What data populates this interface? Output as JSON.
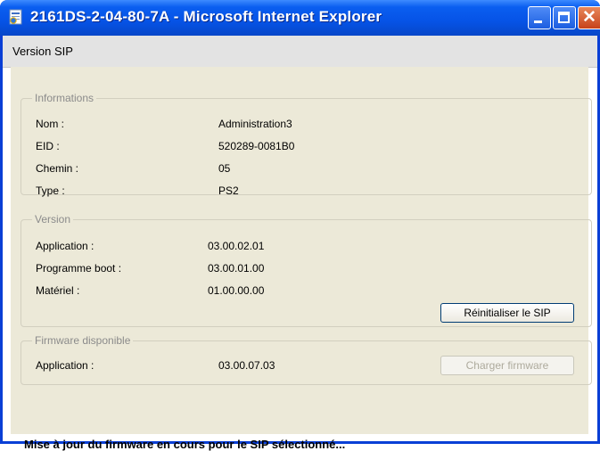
{
  "window": {
    "title": "2161DS-2-04-80-7A - Microsoft Internet Explorer"
  },
  "header": {
    "title": "Version SIP"
  },
  "informations": {
    "legend": "Informations",
    "rows": [
      {
        "label": "Nom :",
        "value": "Administration3"
      },
      {
        "label": "EID :",
        "value": "520289-0081B0"
      },
      {
        "label": "Chemin :",
        "value": "05"
      },
      {
        "label": "Type :",
        "value": "PS2"
      }
    ]
  },
  "version": {
    "legend": "Version",
    "rows": [
      {
        "label": "Application :",
        "value": "03.00.02.01"
      },
      {
        "label": "Programme boot :",
        "value": "03.00.01.00"
      },
      {
        "label": "Matériel :",
        "value": "01.00.00.00"
      }
    ],
    "reset_button": "Réinitialiser le SIP"
  },
  "firmware": {
    "legend": "Firmware disponible",
    "label": "Application :",
    "value": "03.00.07.03",
    "load_button": "Charger firmware",
    "load_button_enabled": false
  },
  "status": {
    "message": "Mise à jour du firmware en cours pour le SIP sélectionné..."
  },
  "icons": {
    "app": "ie-page-icon",
    "minimize": "minimize-icon",
    "maximize": "maximize-icon",
    "close": "close-icon"
  },
  "colors": {
    "titlebar": "#0653e6",
    "panel": "#ece9d8",
    "header": "#e3e3e3",
    "group_border": "#d2cfbf",
    "disabled_text": "#adaa9c"
  }
}
